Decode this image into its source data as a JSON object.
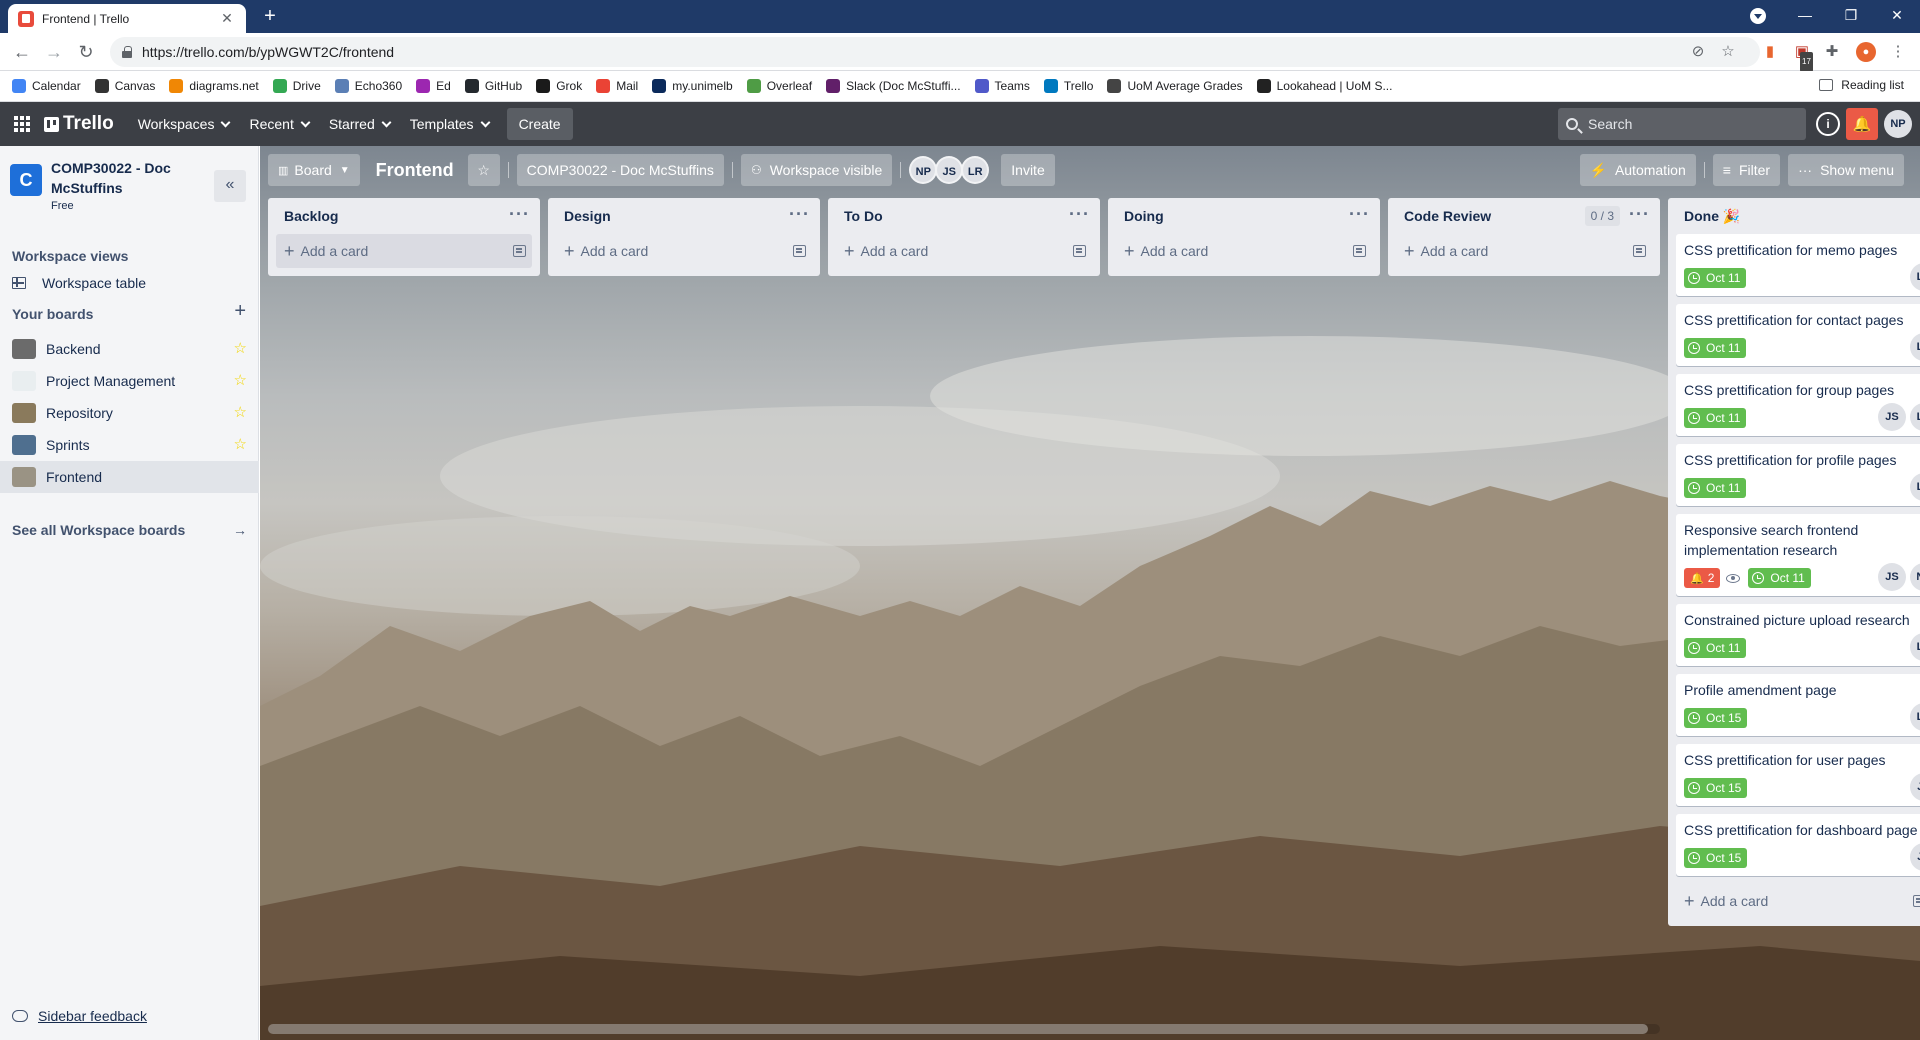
{
  "browser": {
    "tab_title": "Frontend | Trello",
    "url": "https://trello.com/b/ypWGWT2C/frontend",
    "ext_badge": "17",
    "bookmarks": [
      {
        "label": "Calendar",
        "color": "#4285f4"
      },
      {
        "label": "Canvas",
        "color": "#333333"
      },
      {
        "label": "diagrams.net",
        "color": "#f08705"
      },
      {
        "label": "Drive",
        "color": "#34a853"
      },
      {
        "label": "Echo360",
        "color": "#5b7fb5"
      },
      {
        "label": "Ed",
        "color": "#9c27b0"
      },
      {
        "label": "GitHub",
        "color": "#24292e"
      },
      {
        "label": "Grok",
        "color": "#1a1a1a"
      },
      {
        "label": "Mail",
        "color": "#ea4335"
      },
      {
        "label": "my.unimelb",
        "color": "#0b2a5b"
      },
      {
        "label": "Overleaf",
        "color": "#4f9c45"
      },
      {
        "label": "Slack (Doc McStuffi...",
        "color": "#611f69"
      },
      {
        "label": "Teams",
        "color": "#5059c9"
      },
      {
        "label": "Trello",
        "color": "#0079bf"
      },
      {
        "label": "UoM Average Grades",
        "color": "#444444"
      },
      {
        "label": "Lookahead | UoM S...",
        "color": "#222222"
      }
    ],
    "reading_list": "Reading list"
  },
  "header": {
    "logo": "Trello",
    "menus": [
      "Workspaces",
      "Recent",
      "Starred",
      "Templates"
    ],
    "create": "Create",
    "search_placeholder": "Search",
    "info": "i",
    "user_initials": "NP"
  },
  "sidebar": {
    "workspace_initial": "C",
    "workspace_name": "COMP30022 - Doc McStuffins",
    "workspace_plan": "Free",
    "workspace_views_heading": "Workspace views",
    "workspace_table": "Workspace table",
    "your_boards_heading": "Your boards",
    "boards": [
      {
        "name": "Backend",
        "color": "#6b6b6b"
      },
      {
        "name": "Project Management",
        "color": "#e9eef0"
      },
      {
        "name": "Repository",
        "color": "#8a7a5c"
      },
      {
        "name": "Sprints",
        "color": "#4f6f8f"
      },
      {
        "name": "Frontend",
        "color": "#9a9384"
      }
    ],
    "see_all": "See all Workspace boards",
    "feedback": "Sidebar feedback"
  },
  "board_bar": {
    "view": "Board",
    "title": "Frontend",
    "workspace": "COMP30022 - Doc McStuffins",
    "visibility": "Workspace visible",
    "members": [
      "NP",
      "JS",
      "LR"
    ],
    "invite": "Invite",
    "automation": "Automation",
    "filter": "Filter",
    "show_menu": "Show menu"
  },
  "lists": [
    {
      "title": "Backlog",
      "add": "Add a card"
    },
    {
      "title": "Design",
      "add": "Add a card"
    },
    {
      "title": "To Do",
      "add": "Add a card"
    },
    {
      "title": "Doing",
      "add": "Add a card"
    },
    {
      "title": "Code Review",
      "wip": "0 / 3",
      "add": "Add a card"
    }
  ],
  "done_list": {
    "title": "Done 🎉",
    "add": "Add a card",
    "cards": [
      {
        "title": "CSS prettification for memo pages",
        "due": "Oct 11",
        "members": [
          "LR"
        ]
      },
      {
        "title": "CSS prettification for contact pages",
        "due": "Oct 11",
        "members": [
          "LR"
        ]
      },
      {
        "title": "CSS prettification for group pages",
        "due": "Oct 11",
        "members": [
          "JS",
          "LR"
        ]
      },
      {
        "title": "CSS prettification for profile pages",
        "due": "Oct 11",
        "members": [
          "LR"
        ]
      },
      {
        "title": "Responsive search frontend implementation research",
        "notifications": "2",
        "due": "Oct 11",
        "members": [
          "JS",
          "NP"
        ]
      },
      {
        "title": "Constrained picture upload research",
        "due": "Oct 11",
        "members": [
          "LR"
        ]
      },
      {
        "title": "Profile amendment page",
        "due": "Oct 15",
        "members": [
          "LR"
        ]
      },
      {
        "title": "CSS prettification for user pages",
        "due": "Oct 15",
        "members": [
          "JS"
        ]
      },
      {
        "title": "CSS prettification for dashboard page",
        "due": "Oct 15",
        "members": [
          "JS"
        ]
      }
    ]
  }
}
